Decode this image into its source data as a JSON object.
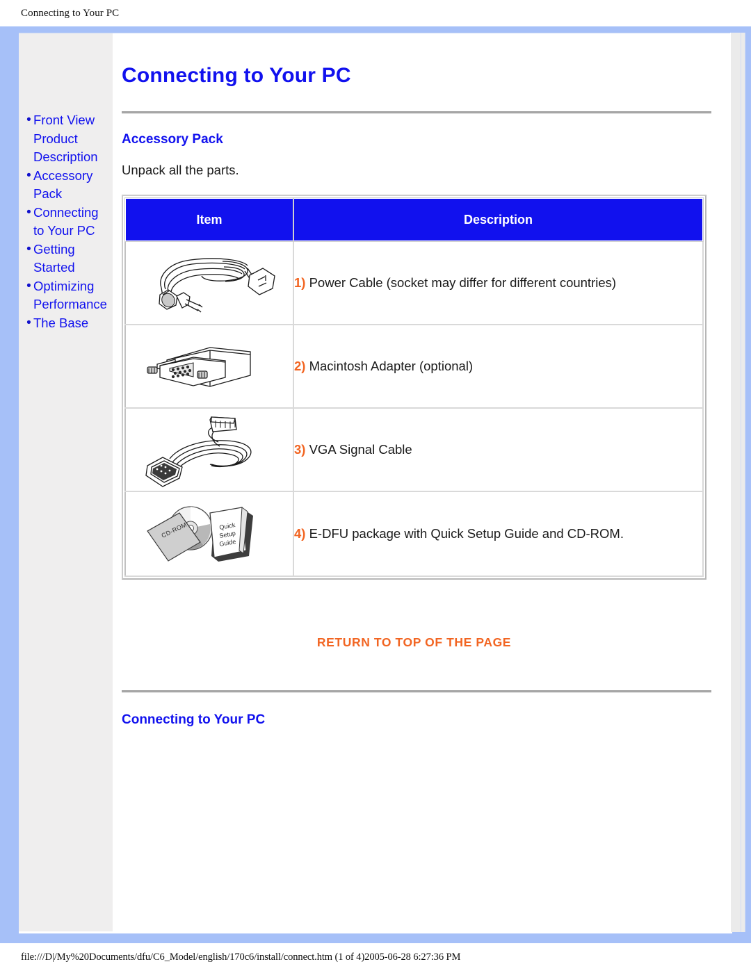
{
  "print_header": {
    "title": "Connecting to Your PC"
  },
  "print_footer": {
    "path": "file:///D|/My%20Documents/dfu/C6_Model/english/170c6/install/connect.htm (1 of 4)2005-06-28 6:27:36 PM"
  },
  "sidebar": {
    "items": [
      {
        "label": "Front View Product Description"
      },
      {
        "label": "Accessory Pack"
      },
      {
        "label": "Connecting to Your PC"
      },
      {
        "label": "Getting Started"
      },
      {
        "label": "Optimizing Performance"
      },
      {
        "label": "The Base"
      }
    ],
    "bullet": "•"
  },
  "main": {
    "page_title": "Connecting to Your PC",
    "section_title": "Accessory Pack",
    "intro_text": "Unpack all the parts.",
    "table": {
      "headers": [
        "Item",
        "Description"
      ],
      "rows": [
        {
          "number": "1)",
          "description": "Power Cable (socket may differ for different countries)",
          "image": "power-cable-illustration"
        },
        {
          "number": "2)",
          "description": "Macintosh Adapter (optional)",
          "image": "macintosh-adapter-illustration"
        },
        {
          "number": "3)",
          "description": "VGA Signal Cable",
          "image": "vga-signal-cable-illustration"
        },
        {
          "number": "4)",
          "description": "E-DFU package with Quick Setup Guide and CD-ROM.",
          "image": "cdrom-and-guide-illustration"
        }
      ]
    },
    "return_top_label": "RETURN TO TOP OF THE PAGE",
    "bottom_title": "Connecting to Your PC"
  },
  "illustration_labels": {
    "cdrom": "CD-ROM",
    "guide_line1": "Quick",
    "guide_line2": "Setup",
    "guide_line3": "Guide"
  },
  "colors": {
    "link_blue": "#1111ee",
    "accent_orange": "#f26522",
    "frame_blue": "#a6c0f8",
    "sidebar_gray": "#efeeee",
    "header_blue": "#1111ee"
  }
}
